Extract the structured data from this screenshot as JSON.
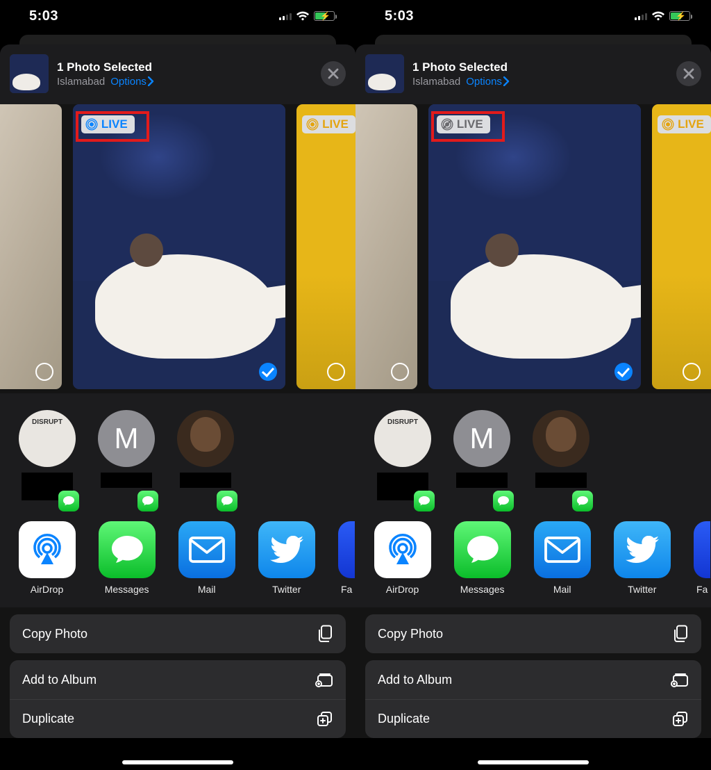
{
  "statusbar": {
    "time": "5:03"
  },
  "sheet": {
    "title": "1 Photo Selected",
    "location": "Islamabad",
    "options_label": "Options"
  },
  "live_badge": {
    "text": "LIVE"
  },
  "contacts": [
    {
      "initial": ""
    },
    {
      "initial": "M"
    },
    {
      "initial": ""
    }
  ],
  "apps": [
    {
      "key": "airdrop",
      "label": "AirDrop"
    },
    {
      "key": "messages",
      "label": "Messages"
    },
    {
      "key": "mail",
      "label": "Mail"
    },
    {
      "key": "twitter",
      "label": "Twitter"
    },
    {
      "key": "partial",
      "label": "Fa"
    }
  ],
  "actions": {
    "copy": "Copy Photo",
    "add_album": "Add to Album",
    "duplicate": "Duplicate"
  },
  "panes": [
    {
      "live_state": "on"
    },
    {
      "live_state": "off"
    }
  ]
}
